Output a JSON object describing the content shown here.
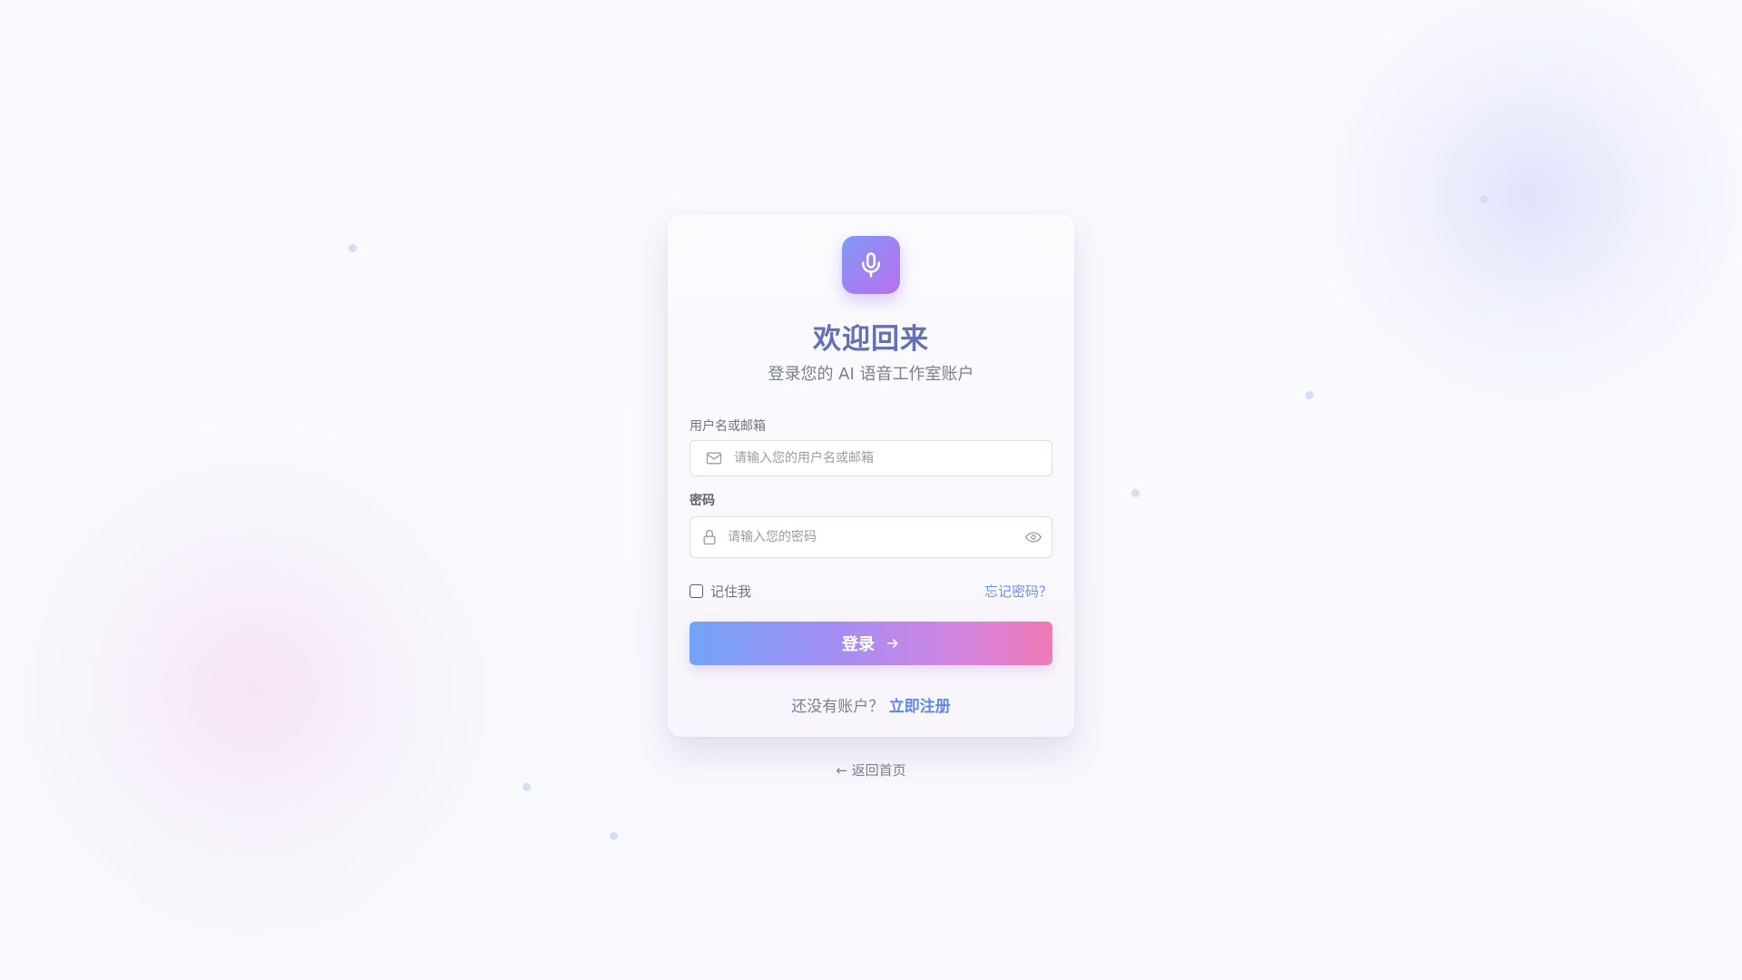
{
  "brand": {
    "icon": "microphone-icon",
    "accent_gradient": [
      "#7d9cf6",
      "#b573ee"
    ]
  },
  "header": {
    "title": "欢迎回来",
    "subtitle": "登录您的 AI 语音工作室账户"
  },
  "form": {
    "username": {
      "label": "用户名或邮箱",
      "placeholder": "请输入您的用户名或邮箱",
      "value": "",
      "icon": "mail-icon"
    },
    "password": {
      "label": "密码",
      "placeholder": "请输入您的密码",
      "value": "",
      "icon": "lock-icon",
      "toggle_icon": "eye-icon"
    },
    "remember_me": {
      "label": "记住我",
      "checked": false
    },
    "forgot_password": "忘记密码？",
    "submit": {
      "label": "登录",
      "icon": "arrow-right-icon",
      "gradient": [
        "#73a3f7",
        "#f07ab6"
      ]
    }
  },
  "footer": {
    "no_account": "还没有账户？",
    "register": "立即注册",
    "back_home": "← 返回首页"
  },
  "colors": {
    "title": "#6570b6",
    "link": "#6c92e8",
    "background": "#f8f9fd"
  }
}
